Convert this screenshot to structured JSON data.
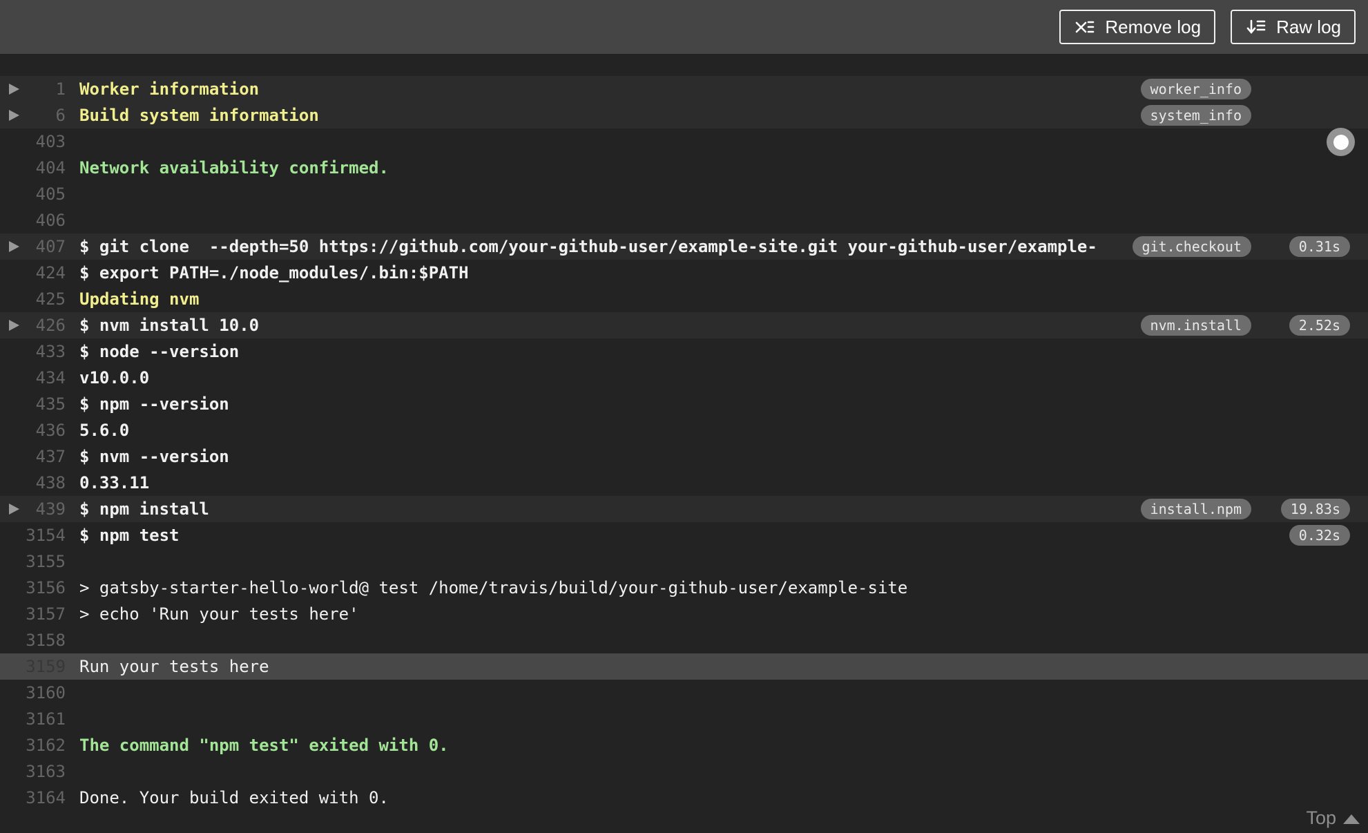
{
  "toolbar": {
    "buttons": [
      {
        "label": "Remove log",
        "icon": "remove-log-icon"
      },
      {
        "label": "Raw log",
        "icon": "raw-log-icon"
      }
    ]
  },
  "log": {
    "rows": [
      {
        "num": "1",
        "text": "Worker information",
        "color": "yellow",
        "bold": true,
        "fold": true,
        "badge": "worker_info"
      },
      {
        "num": "6",
        "text": "Build system information",
        "color": "yellow",
        "bold": true,
        "fold": true,
        "badge": "system_info"
      },
      {
        "num": "403",
        "text": ""
      },
      {
        "num": "404",
        "text": "Network availability confirmed.",
        "color": "green",
        "bold": true
      },
      {
        "num": "405",
        "text": ""
      },
      {
        "num": "406",
        "text": ""
      },
      {
        "num": "407",
        "text": "$ git clone  --depth=50 https://github.com/your-github-user/example-site.git your-github-user/example-",
        "bold": true,
        "fold": true,
        "badge": "git.checkout",
        "duration": "0.31s"
      },
      {
        "num": "424",
        "text": "$ export PATH=./node_modules/.bin:$PATH",
        "bold": true
      },
      {
        "num": "425",
        "text": "Updating nvm",
        "color": "yellow",
        "bold": true
      },
      {
        "num": "426",
        "text": "$ nvm install 10.0",
        "bold": true,
        "fold": true,
        "badge": "nvm.install",
        "duration": "2.52s"
      },
      {
        "num": "433",
        "text": "$ node --version",
        "bold": true
      },
      {
        "num": "434",
        "text": "v10.0.0",
        "bold": true
      },
      {
        "num": "435",
        "text": "$ npm --version",
        "bold": true
      },
      {
        "num": "436",
        "text": "5.6.0",
        "bold": true
      },
      {
        "num": "437",
        "text": "$ nvm --version",
        "bold": true
      },
      {
        "num": "438",
        "text": "0.33.11",
        "bold": true
      },
      {
        "num": "439",
        "text": "$ npm install",
        "bold": true,
        "fold": true,
        "badge": "install.npm",
        "duration": "19.83s"
      },
      {
        "num": "3154",
        "text": "$ npm test",
        "bold": true,
        "duration": "0.32s"
      },
      {
        "num": "3155",
        "text": ""
      },
      {
        "num": "3156",
        "text": "> gatsby-starter-hello-world@ test /home/travis/build/your-github-user/example-site"
      },
      {
        "num": "3157",
        "text": "> echo 'Run your tests here'"
      },
      {
        "num": "3158",
        "text": ""
      },
      {
        "num": "3159",
        "text": "Run your tests here",
        "highlight": true
      },
      {
        "num": "3160",
        "text": ""
      },
      {
        "num": "3161",
        "text": ""
      },
      {
        "num": "3162",
        "text": "The command \"npm test\" exited with 0.",
        "color": "green",
        "bold": true
      },
      {
        "num": "3163",
        "text": ""
      },
      {
        "num": "3164",
        "text": "Done. Your build exited with 0."
      }
    ],
    "top_link_label": "Top"
  },
  "colors": {
    "toolbar_bg": "#454545",
    "log_bg": "#232323",
    "fold_row_bg": "#2c2c2c",
    "highlight_row_bg": "#484848",
    "text": "#f1f1f1",
    "ansi_yellow": "#f1ee8e",
    "ansi_green": "#a3e596",
    "line_number": "#656565",
    "badge_bg": "#6d6d6d",
    "badge_text": "#e8e8e8"
  }
}
